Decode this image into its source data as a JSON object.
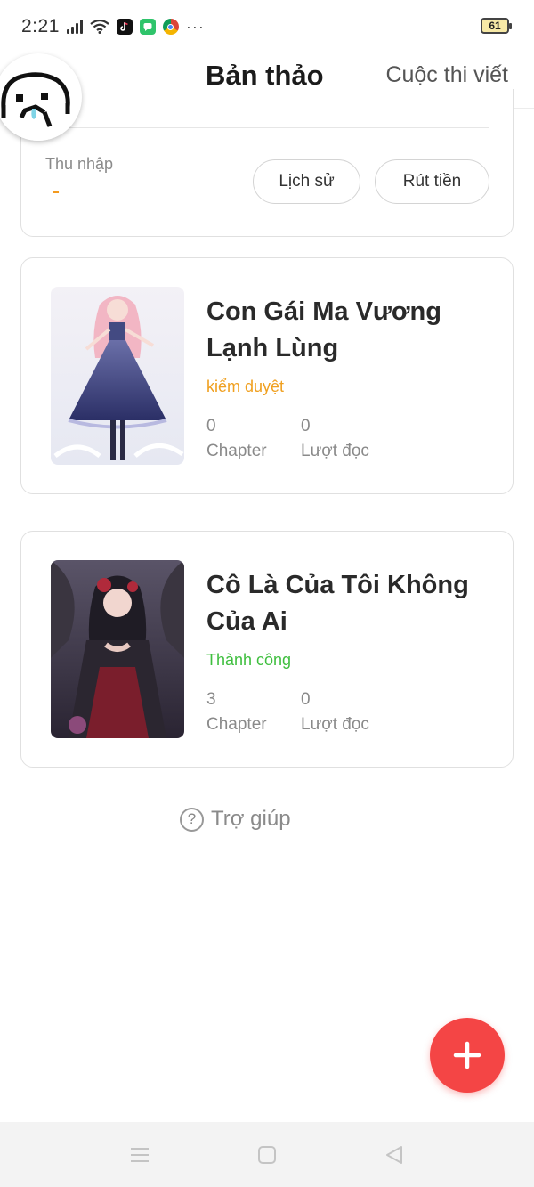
{
  "status_bar": {
    "time": "2:21",
    "battery_level": "61",
    "icons": [
      "signal-icon",
      "wifi-icon",
      "tiktok-icon",
      "chat-icon",
      "chrome-icon",
      "more-icon"
    ],
    "more": "···"
  },
  "header": {
    "tab_drafts": "Bản thảo",
    "tab_contest": "Cuộc thi viết"
  },
  "income": {
    "label": "Thu nhập",
    "value": "-",
    "history_button": "Lịch sử",
    "withdraw_button": "Rút tiền"
  },
  "stories": [
    {
      "title": "Con Gái Ma Vương Lạnh Lùng",
      "status": "kiểm duyệt",
      "chapters": "0",
      "chapters_label": "Chapter",
      "reads": "0",
      "reads_label": "Lượt đọc"
    },
    {
      "title": "Cô Là Của Tôi Không Của Ai",
      "status": "Thành công",
      "chapters": "3",
      "chapters_label": "Chapter",
      "reads": "0",
      "reads_label": "Lượt đọc"
    }
  ],
  "help": {
    "label": "Trợ giúp",
    "icon_glyph": "?"
  },
  "colors": {
    "accent_red": "#f44545",
    "income_orange": "#f39a1f",
    "status_review": "#f0a020",
    "status_success": "#3fbf3f"
  }
}
